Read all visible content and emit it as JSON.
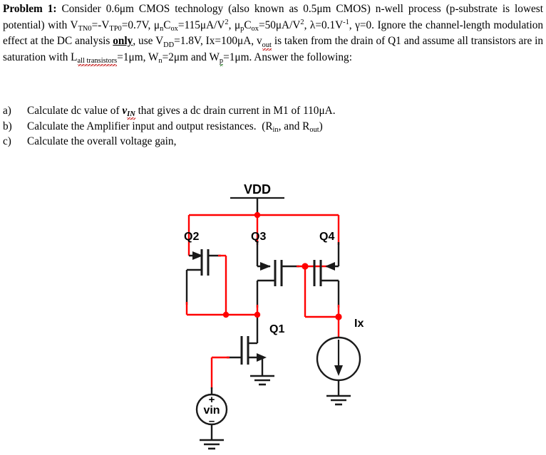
{
  "problem": {
    "label": "Problem 1",
    "colon": ":",
    "seg1": "Consider 0.6μm CMOS technology (also known as 0.5μm CMOS) n-well process (p-substrate is lowest potential) with",
    "v_tn0": "V",
    "v_tn0_sub": "TN0",
    "eq_neg": "=-V",
    "v_tp0_sub": "TP0",
    "v_tp0_val": "=0.7V,",
    "mu_n": "μ",
    "mu_n_sub": "n",
    "cox1": "C",
    "cox1_sub": "ox",
    "cox1_val": "=115μA/V",
    "cox1_sup": "2",
    "comma1": ",",
    "mu_p": "μ",
    "mu_p_sub": "p",
    "cox2": "C",
    "cox2_sub": "ox",
    "cox2_val": "=50μA/V",
    "cox2_sup": "2",
    "comma2": ",",
    "lambda": "λ=0.1V",
    "lambda_sup": "-1",
    "lambda_tail": ",",
    "gamma": "γ=0.",
    "seg2": "Ignore the channel-length modulation effect at the DC analysis",
    "only": "only",
    "seg3": ", use",
    "vdd": "V",
    "vdd_sub": "DD",
    "vdd_val": "=1.8V, Ix=100μA,",
    "vout": "v",
    "vout_sub": "out",
    "seg4": "is taken from the drain of Q1 and assume all transistors are in saturation with",
    "l_sym": "L",
    "l_sub": "all transistors",
    "l_val": "=1μm, W",
    "wn_sub": "n",
    "wn_val": "=2μm and W",
    "wp_sub": "p",
    "wp_val": "=1μm.",
    "seg5": "Answer the following:"
  },
  "questions": [
    {
      "marker": "a)",
      "pre": "Calculate dc value of",
      "var": "v",
      "var_sub": "IN",
      "post": "that gives a dc drain current in M1 of 110μA."
    },
    {
      "marker": "b)",
      "pre": "Calculate the Amplifier input and output resistances.",
      "paren_open": "(R",
      "rin_sub": "in",
      "mid": ", and R",
      "rout_sub": "out",
      "paren_close": ")"
    },
    {
      "marker": "c)",
      "pre": "Calculate the overall voltage gain,",
      "post": ""
    }
  ],
  "schematic": {
    "supply_label": "VDD",
    "transistors": [
      {
        "id": "Q2",
        "label": "Q2",
        "type": "pmos"
      },
      {
        "id": "Q3",
        "label": "Q3",
        "type": "pmos"
      },
      {
        "id": "Q4",
        "label": "Q4",
        "type": "pmos"
      },
      {
        "id": "Q1",
        "label": "Q1",
        "type": "nmos"
      }
    ],
    "sources": [
      {
        "id": "Ix",
        "label": "Ix",
        "type": "current-source",
        "direction": "down"
      },
      {
        "id": "vin",
        "label": "vin",
        "type": "voltage-source",
        "plus": "+",
        "minus": "–"
      }
    ],
    "colors": {
      "wire_red": "#FF0000",
      "wire_black": "#1a1a1a",
      "node_dot": "#FF0000"
    }
  }
}
